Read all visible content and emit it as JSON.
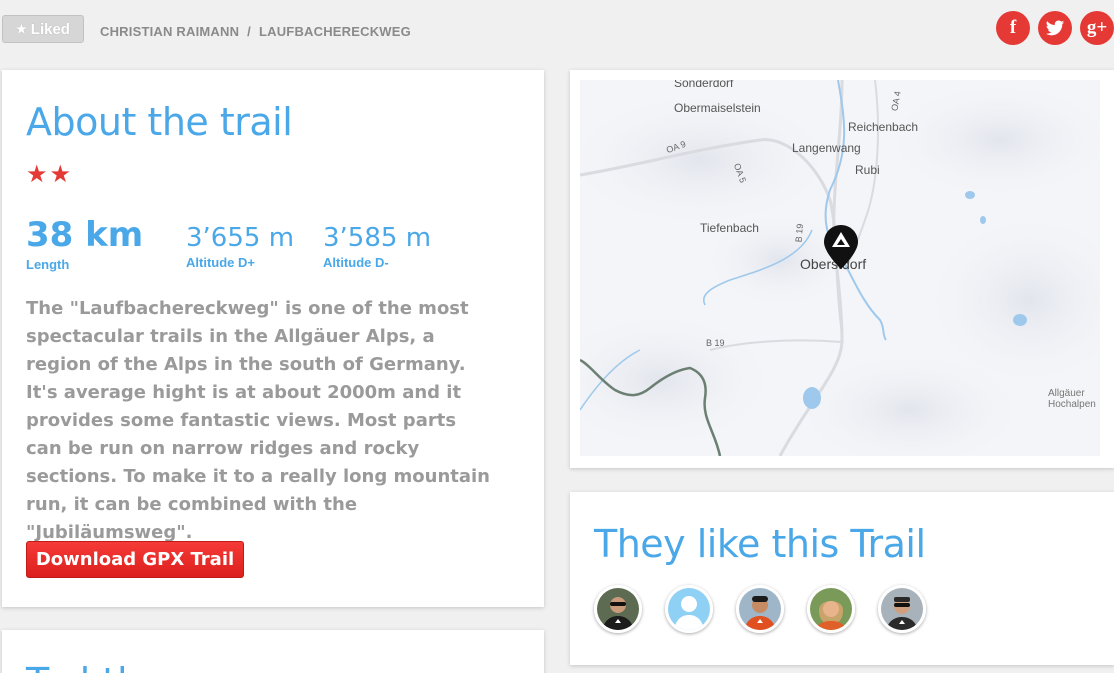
{
  "header": {
    "liked_label": "Liked",
    "breadcrumb": {
      "author": "CHRISTIAN RAIMANN",
      "separator": "/",
      "trail": "LAUFBACHERECKWEG"
    },
    "social": [
      {
        "name": "facebook",
        "glyph": "f"
      },
      {
        "name": "twitter",
        "glyph": "twitter-bird-icon"
      },
      {
        "name": "google-plus",
        "glyph": "g+"
      }
    ]
  },
  "about": {
    "title": "About the trail",
    "rating": 2,
    "stats": [
      {
        "value": "38 km",
        "label": "Length"
      },
      {
        "value": "3’655 m",
        "label": "Altitude D+"
      },
      {
        "value": "3’585 m",
        "label": "Altitude D-"
      }
    ],
    "description": "The \"Laufbachereckweg\" is one of the most spectacular trails in the Allgäuer Alps, a region of the Alps in the south of Germany. It's average hight is at about 2000m and it provides some fantastic views. Most parts can be run on narrow ridges and rocky sections. To make it to a really long mountain run, it can be combined with the \"Jubiläumsweg\".",
    "download_label": "Download GPX Trail"
  },
  "next_section_title": "Tod       th",
  "map": {
    "places": {
      "sonderdorf": "Sonderdorf",
      "obermaiselstein": "Obermaiselstein",
      "reichenbach": "Reichenbach",
      "langenwang": "Langenwang",
      "rubi": "Rubi",
      "tiefenbach": "Tiefenbach",
      "oberstdorf": "Oberstdorf",
      "allgaeuer": "Allgäuer",
      "hochalpen": "Hochalpen"
    },
    "roads": {
      "oa9": "OA 9",
      "oa5": "OA 5",
      "oa4": "OA 4",
      "b19_vertical": "B 19",
      "b19": "B 19"
    },
    "water_color": "#9ec9ec",
    "border_color": "#6b7f72"
  },
  "likes": {
    "title": "They like this Trail",
    "users": [
      "user-1",
      "user-2",
      "user-3",
      "user-4",
      "user-5"
    ]
  },
  "colors": {
    "accent_blue": "#4aa8e8",
    "accent_red": "#e53935",
    "text_gray": "#9a9a9a"
  }
}
